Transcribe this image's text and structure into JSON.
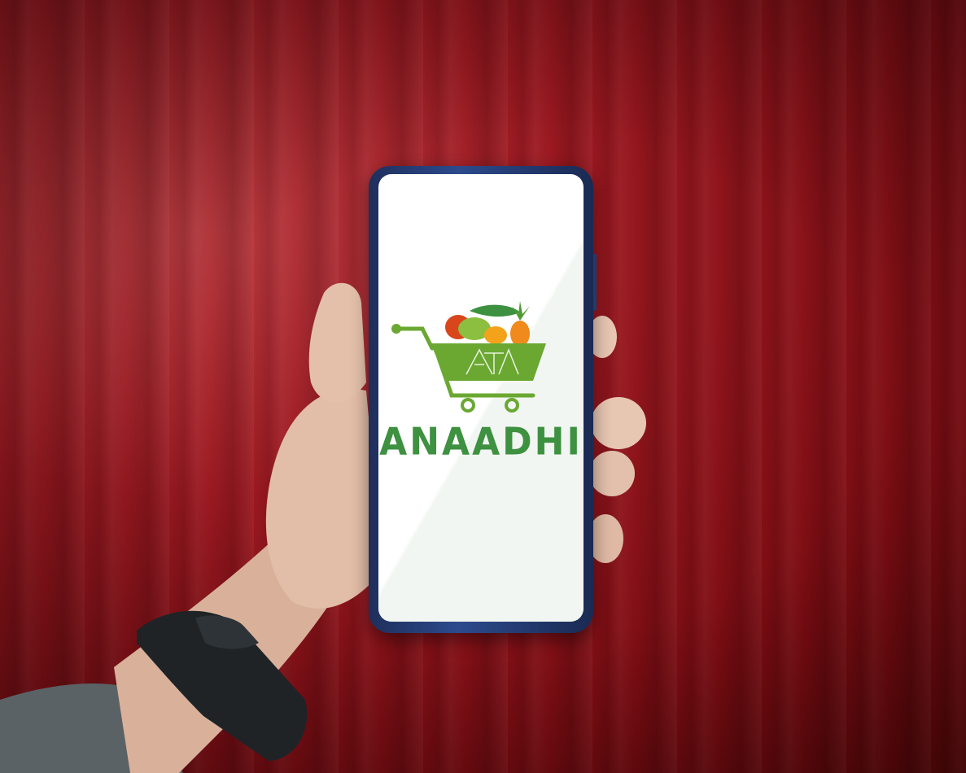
{
  "brand": {
    "name": "ANAADHI",
    "color": "#3d9140",
    "cart_color": "#6aa832"
  },
  "background": {
    "color": "#9b1820"
  },
  "device": {
    "frame_color": "#2c4a8c",
    "screen_color": "#ffffff"
  }
}
